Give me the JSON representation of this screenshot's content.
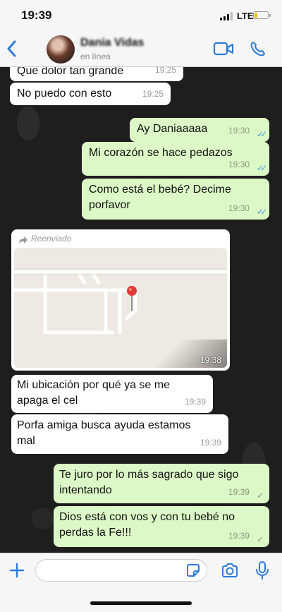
{
  "status_bar": {
    "time": "19:39",
    "network": "LTE"
  },
  "header": {
    "contact_name": "Dania Vidas",
    "contact_status": "en línea"
  },
  "messages": [
    {
      "direction": "in",
      "text": "Que dolor tan grande",
      "time": "19:25"
    },
    {
      "direction": "in",
      "text": "No puedo con esto",
      "time": "19:25"
    },
    {
      "direction": "out",
      "text": "Ay Daniaaaaa",
      "time": "19:30",
      "status": "read"
    },
    {
      "direction": "out",
      "text": "Mi corazón se hace pedazos",
      "time": "19:30",
      "status": "read"
    },
    {
      "direction": "out",
      "text": "Como está el bebé? Decime\nporfavor",
      "time": "19:30",
      "status": "read"
    },
    {
      "direction": "in",
      "type": "location",
      "forward_label": "Reenviado",
      "time": "19:38"
    },
    {
      "direction": "in",
      "text": "Mi ubicación por qué ya se me\napaga el cel",
      "time": "19:39"
    },
    {
      "direction": "in",
      "text": "Porfa amiga busca ayuda estamos\nmal",
      "time": "19:39"
    },
    {
      "direction": "out",
      "text": "Te juro por lo más sagrado que sigo\nintentando",
      "time": "19:39",
      "status": "sent"
    },
    {
      "direction": "out",
      "text": "Dios está con vos y con tu bebé no\nperdas la Fe!!!",
      "time": "19:39",
      "status": "sent"
    }
  ],
  "composer": {
    "placeholder": ""
  },
  "colors": {
    "accent": "#2f7bd8",
    "outgoing_bubble": "#dcf8c6",
    "incoming_bubble": "#ffffff",
    "read_tick": "#4aa3e0"
  }
}
